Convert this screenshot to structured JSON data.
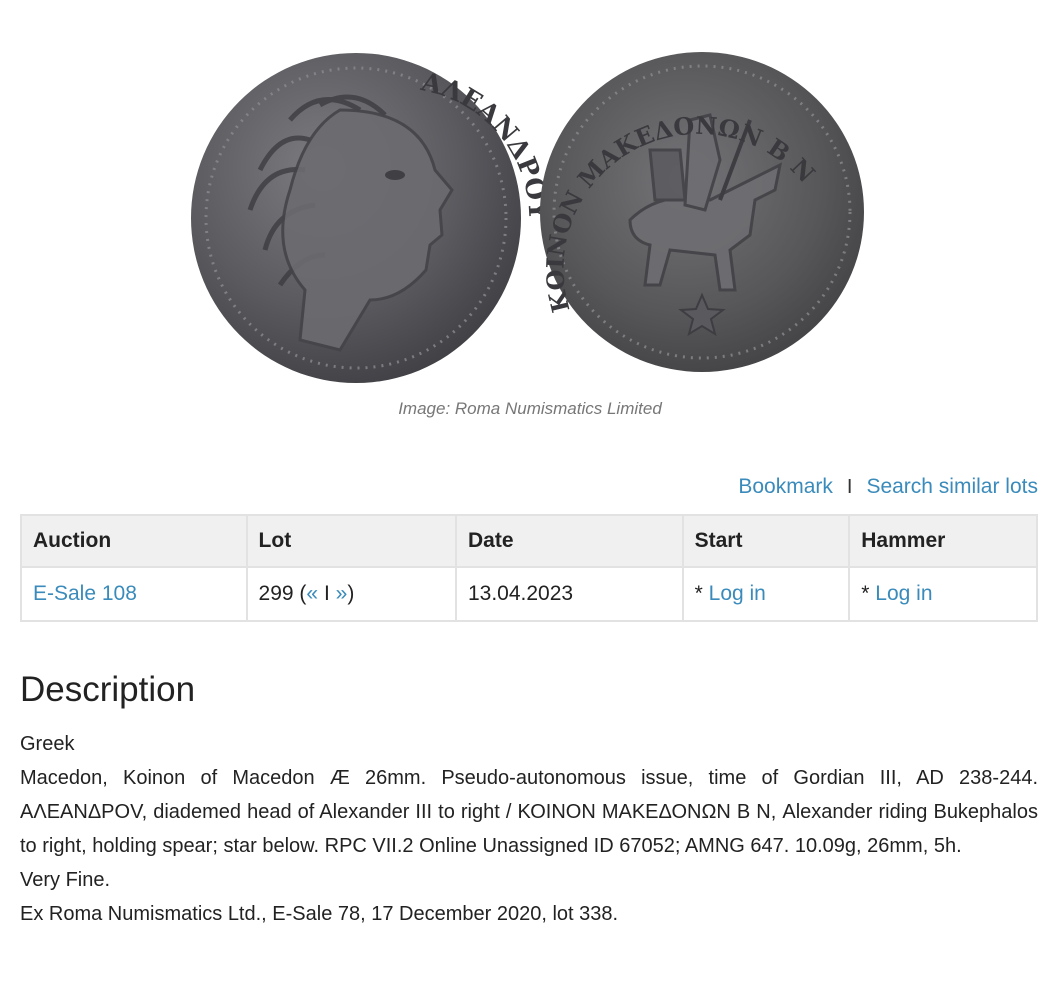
{
  "image": {
    "caption": "Image: Roma Numismatics Limited",
    "obverse_legend": "ΑΛΕΑΝΔΡΟΥ",
    "reverse_legend": "ΚΟΙΝΟΝ ΜΑΚΕΔΟΝΩΝ Β Ν"
  },
  "actions": {
    "bookmark": "Bookmark",
    "separator": "I",
    "search_similar": "Search similar lots"
  },
  "table": {
    "headers": {
      "auction": "Auction",
      "lot": "Lot",
      "date": "Date",
      "start": "Start",
      "hammer": "Hammer"
    },
    "row": {
      "auction": "E-Sale 108",
      "lot_number": "299 (",
      "prev": "«",
      "lot_sep": " I ",
      "next": "»",
      "lot_close": ")",
      "date": "13.04.2023",
      "start_prefix": "* ",
      "start_link": "Log in",
      "hammer_prefix": "* ",
      "hammer_link": "Log in"
    }
  },
  "description": {
    "heading": "Description",
    "category": "Greek",
    "text": "Macedon, Koinon of Macedon Æ 26mm. Pseudo-autonomous issue, time of Gordian III, AD 238-244. ΑΛΕΑΝΔΡΟV, diademed head of Alexander III to right / ΚΟΙΝΟΝ ΜΑΚΕΔΟΝΩΝ Β Ν, Alexander riding Bukephalos to right, holding spear; star below. RPC VII.2 Online Unassigned ID 67052; AMNG 647. 10.09g, 26mm, 5h.",
    "grade": "Very Fine.",
    "provenance": "Ex Roma Numismatics Ltd., E-Sale 78, 17 December 2020, lot 338."
  },
  "colors": {
    "link": "#3a8bbb",
    "header_bg": "#f0f0f0",
    "border": "#e2e2e2",
    "coin_metal": "#5a5a5e"
  }
}
